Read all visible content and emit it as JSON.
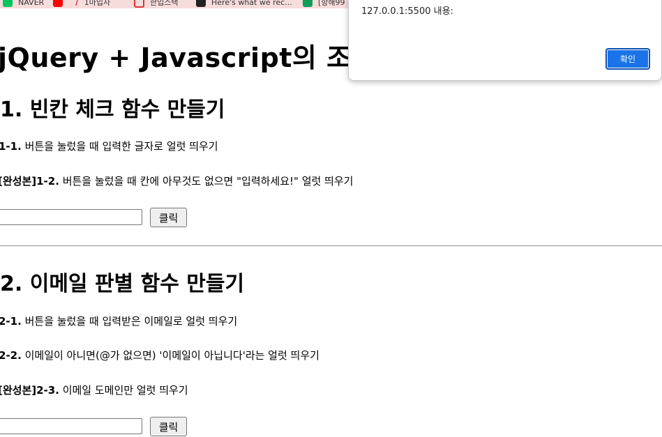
{
  "bookmarks": [
    {
      "label": "NAVER",
      "icon": "naver-icon"
    },
    {
      "label": "",
      "icon": "youtube-icon"
    },
    {
      "label": "1마입사",
      "icon": "link-icon"
    },
    {
      "label": "한입스택",
      "icon": "chart-icon"
    },
    {
      "label": "Here's what we rec...",
      "icon": "github-icon"
    },
    {
      "label": "[항해99",
      "icon": "bookmark-icon"
    }
  ],
  "page": {
    "title": "jQuery + Javascript의 조합",
    "section1": {
      "heading": "1. 빈칸 체크 함수 만들기",
      "task1_num": "1-1.",
      "task1_text": "버튼을 눌렀을 때 입력한 글자로 얼럿 띄우기",
      "task2_num": "[완성본]1-2.",
      "task2_text": "버튼을 눌렀을 때 칸에 아무것도 없으면 \"입력하세요!\" 얼럿 띄우기",
      "input_value": "",
      "button_label": "클릭"
    },
    "section2": {
      "heading": "2. 이메일 판별 함수 만들기",
      "task1_num": "2-1.",
      "task1_text": "버튼을 눌렀을 때 입력받은 이메일로 얼럿 띄우기",
      "task2_num": "2-2.",
      "task2_text": "이메일이 아니면(@가 없으면) '이메일이 아닙니다'라는 얼럿 띄우기",
      "task3_num": "[완성본]2-3.",
      "task3_text": "이메일 도메인만 얼럿 띄우기",
      "input_value": "",
      "button_label": "클릭"
    }
  },
  "alert": {
    "origin": "127.0.0.1:5500 내용:",
    "ok_label": "확인"
  },
  "colors": {
    "bookmark_bar": "#f7dcdc",
    "alert_button": "#1a73e8"
  }
}
